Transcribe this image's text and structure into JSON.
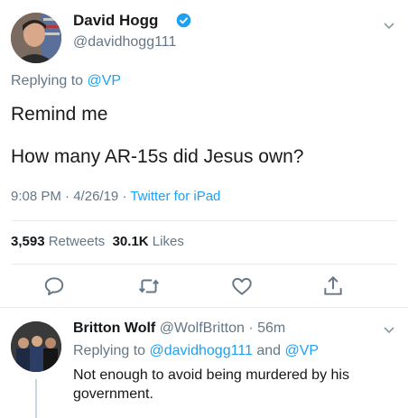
{
  "tweet": {
    "author_name": "David Hogg",
    "author_handle": "@davidhogg111",
    "replying_prefix": "Replying to ",
    "replying_to": "@VP",
    "line1": "Remind me",
    "line2": "How many AR-15s did Jesus own?",
    "time": "9:08 PM",
    "date": "4/26/19",
    "separator": "·",
    "source": "Twitter for iPad",
    "retweets_count": "3,593",
    "retweets_label": "Retweets",
    "likes_count": "30.1K",
    "likes_label": "Likes"
  },
  "reply": {
    "author_name": "Britton Wolf",
    "author_handle": "@WolfBritton",
    "separator": "·",
    "age": "56m",
    "replying_prefix": "Replying to ",
    "replying_to_1": "@davidhogg111",
    "replying_and": " and ",
    "replying_to_2": "@VP",
    "text": "Not enough to avoid being murdered by his government."
  },
  "icons": {
    "verified": "verified-badge-icon",
    "caret": "chevron-down-icon",
    "reply": "reply-icon",
    "retweet": "retweet-icon",
    "like": "heart-icon",
    "share": "share-icon"
  },
  "colors": {
    "accent": "#1da1f2",
    "secondary_text": "#657786",
    "primary_text": "#14171a",
    "divider": "#e6ecf0"
  }
}
